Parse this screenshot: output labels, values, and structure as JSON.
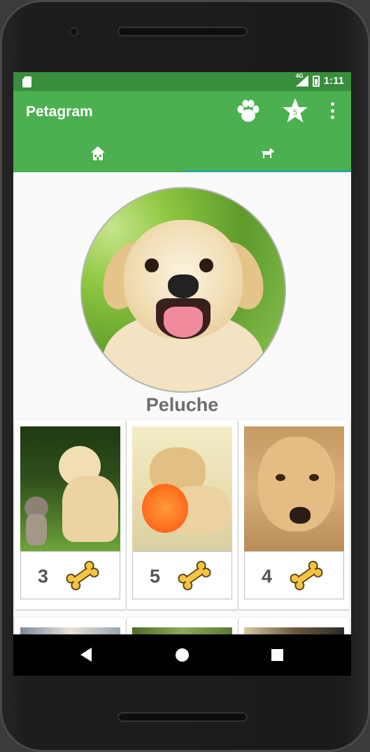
{
  "app": {
    "title": "Petagram"
  },
  "status_bar": {
    "time": "1:11",
    "network": "4G"
  },
  "toolbar": {
    "paw_icon": "paw-icon",
    "favorites_icon": "star-icon",
    "favorites_badge": "5",
    "more_icon": "more-vert-icon"
  },
  "tabs": [
    {
      "icon": "home-icon",
      "selected": false
    },
    {
      "icon": "dog-icon",
      "selected": true
    }
  ],
  "profile": {
    "name": "Peluche"
  },
  "photos": [
    {
      "likes": "3"
    },
    {
      "likes": "5"
    },
    {
      "likes": "4"
    }
  ],
  "colors": {
    "primary": "#4caf50",
    "primary_dark": "#388e3c",
    "tab_indicator": "#26a69a",
    "bone": "#f5c542"
  }
}
